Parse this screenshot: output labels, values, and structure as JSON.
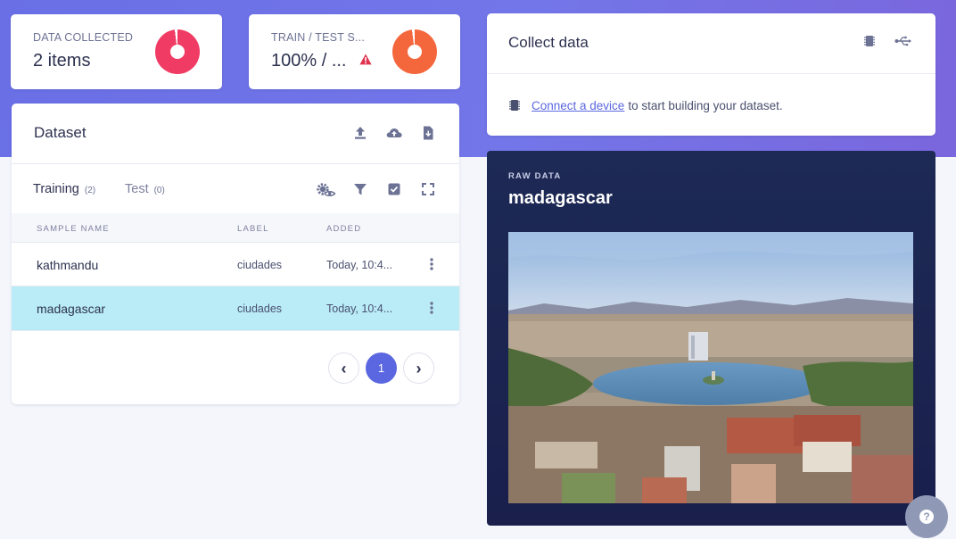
{
  "stats": {
    "collected": {
      "label": "DATA COLLECTED",
      "value": "2 items",
      "color": "#f03c64"
    },
    "split": {
      "label": "TRAIN / TEST S...",
      "value": "100% / ...",
      "color": "#f4673d",
      "warning": true
    }
  },
  "dataset": {
    "title": "Dataset",
    "header_icons": [
      "upload-icon",
      "cloud-upload-icon",
      "file-icon"
    ],
    "tabs": [
      {
        "label": "Training",
        "count": "(2)",
        "active": true
      },
      {
        "label": "Test",
        "count": "(0)",
        "active": false
      }
    ],
    "tool_icons": [
      "settings-eye-icon",
      "filter-icon",
      "checkbox-icon",
      "expand-icon"
    ],
    "columns": [
      "SAMPLE NAME",
      "LABEL",
      "ADDED"
    ],
    "rows": [
      {
        "name": "kathmandu",
        "label": "ciudades",
        "added": "Today, 10:4...",
        "selected": false
      },
      {
        "name": "madagascar",
        "label": "ciudades",
        "added": "Today, 10:4...",
        "selected": true
      }
    ],
    "pagination": {
      "prev": "‹",
      "page": "1",
      "next": "›"
    }
  },
  "collect": {
    "title": "Collect data",
    "header_icons": [
      "chip-icon",
      "usb-icon"
    ],
    "link_text": "Connect a device",
    "message_rest": "to start building your dataset."
  },
  "raw_data": {
    "label": "RAW DATA",
    "sample_name": "madagascar",
    "image_desc": "city-lake-photo"
  },
  "help": {
    "icon": "help-icon",
    "glyph": "?"
  },
  "colors": {
    "accent": "#5a67e0",
    "selected_row": "#b9ecf7",
    "banner": "#6d6fe6",
    "raw_bg": "#1b2150"
  }
}
